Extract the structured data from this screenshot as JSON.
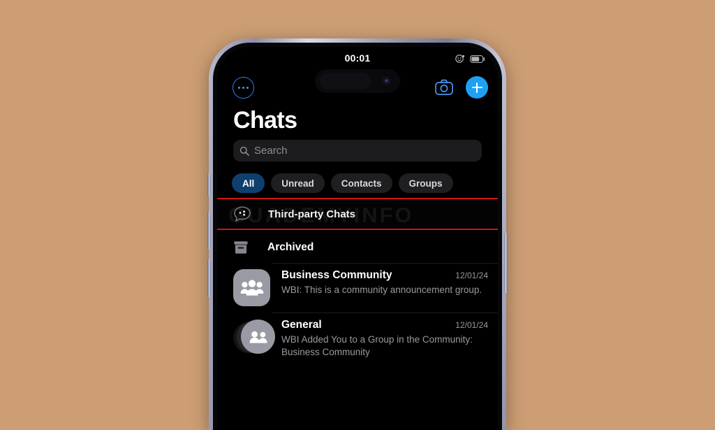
{
  "background_color": "#cd9e74",
  "accent_color": "#1ea1f4",
  "annotation_color": "#cf1414",
  "status_bar": {
    "time": "00:01",
    "icons": [
      "face-id-icon",
      "battery-icon"
    ]
  },
  "dynamic_island": {
    "camera_icon": "front-camera-icon"
  },
  "nav_bar": {
    "more_icon": "more-circle-icon",
    "camera_icon": "camera-icon",
    "add_icon": "plus-icon"
  },
  "header": {
    "title": "Chats"
  },
  "search": {
    "placeholder": "Search",
    "icon": "search-icon"
  },
  "filters": [
    {
      "label": "All",
      "active": true
    },
    {
      "label": "Unread",
      "active": false
    },
    {
      "label": "Contacts",
      "active": false
    },
    {
      "label": "Groups",
      "active": false
    }
  ],
  "third_party": {
    "label": "Third-party Chats",
    "icon": "speech-bubble-dots-icon",
    "watermark": "GUADEMYINFO",
    "highlighted": true
  },
  "archived": {
    "label": "Archived",
    "icon": "archive-box-icon"
  },
  "chats": [
    {
      "name": "Business Community",
      "time": "12/01/24",
      "preview": "WBI: This is a community announcement group.",
      "avatar": "group-three-people-icon",
      "avatar_style": "rounded-square"
    },
    {
      "name": "General",
      "time": "12/01/24",
      "preview": "WBI Added You to a Group in the Community: Business Community",
      "avatar": "group-two-people-icon",
      "avatar_style": "stacked-circle"
    }
  ]
}
